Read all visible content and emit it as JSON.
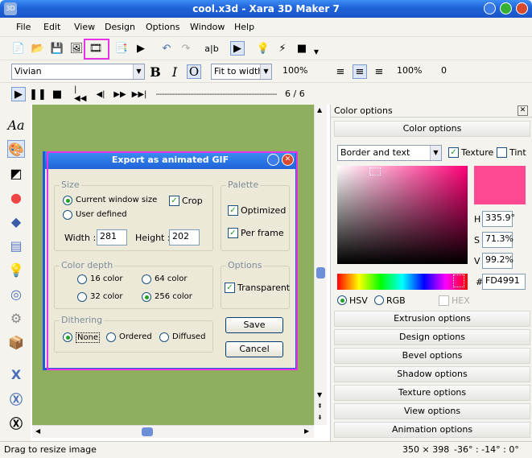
{
  "app": {
    "title": "cool.x3d - Xara 3D Maker 7"
  },
  "menu": [
    "File",
    "Edit",
    "View",
    "Design",
    "Options",
    "Window",
    "Help"
  ],
  "toolbar2": {
    "font": "Vivian",
    "fit": "Fit to width",
    "zoom1": "100%",
    "zoom2": "100%",
    "val": "0"
  },
  "toolbar3": {
    "frame": "6 / 6"
  },
  "dialog": {
    "title": "Export as animated GIF",
    "size_label": "Size",
    "current_window_size": "Current window size",
    "user_defined": "User defined",
    "crop": "Crop",
    "width_label": "Width :",
    "width": "281",
    "height_label": "Height :",
    "height": "202",
    "palette_label": "Palette",
    "optimized": "Optimized",
    "per_frame": "Per frame",
    "color_depth_label": "Color depth",
    "c16": "16 color",
    "c64": "64 color",
    "c32": "32 color",
    "c256": "256 color",
    "options_label": "Options",
    "transparent": "Transparent",
    "dithering_label": "Dithering",
    "none": "None",
    "ordered": "Ordered",
    "diffused": "Diffused",
    "save": "Save",
    "cancel": "Cancel"
  },
  "panel": {
    "title": "Color options",
    "section": "Color options",
    "target": "Border and text",
    "texture": "Texture",
    "tint": "Tint",
    "h_label": "H",
    "h": "335.9°",
    "s_label": "S",
    "s": "71.3%",
    "v_label": "V",
    "v": "99.2%",
    "hash": "#",
    "hex": "FD4991",
    "hsv": "HSV",
    "rgb": "RGB",
    "hexopt": "HEX",
    "sections": [
      "Extrusion options",
      "Design options",
      "Bevel options",
      "Shadow options",
      "Texture options",
      "View options",
      "Animation options"
    ]
  },
  "status": {
    "left": "Drag to resize image",
    "size": "350 × 398",
    "angles": "-36° : -14° : 0°"
  },
  "colors": {
    "selected": "#FD4991",
    "canvas": "#8faf5e",
    "highlight": "#e832e8"
  }
}
